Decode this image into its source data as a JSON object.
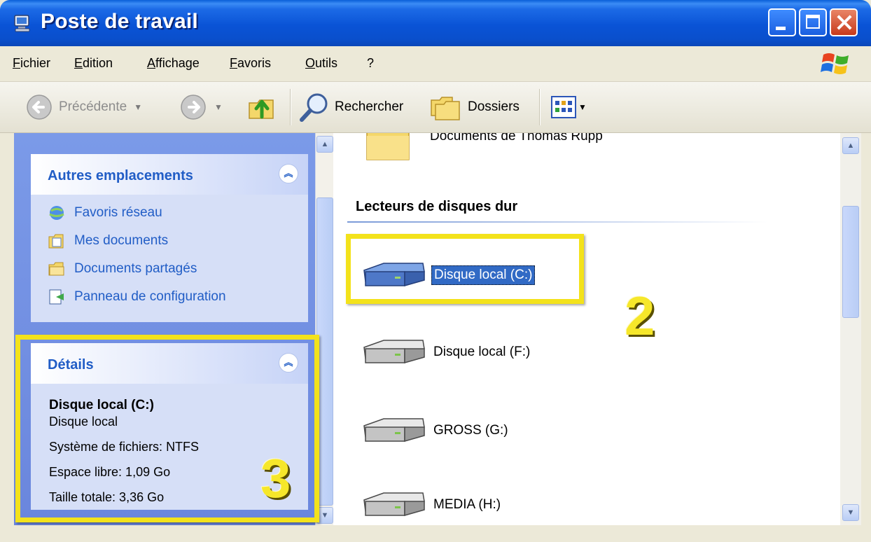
{
  "window": {
    "title": "Poste de travail"
  },
  "menu": [
    "Fichier",
    "Edition",
    "Affichage",
    "Favoris",
    "Outils",
    "?"
  ],
  "toolbar": {
    "back_label": "Précédente",
    "search_label": "Rechercher",
    "folders_label": "Dossiers"
  },
  "left_pane": {
    "other_places": {
      "title": "Autres emplacements",
      "links": [
        "Favoris réseau",
        "Mes documents",
        "Documents partagés",
        "Panneau de configuration"
      ]
    },
    "details": {
      "title": "Détails",
      "name": "Disque local (C:)",
      "type": "Disque local",
      "filesystem": "Système de fichiers: NTFS",
      "free_space": "Espace libre: 1,09 Go",
      "total_size": "Taille totale: 3,36 Go"
    }
  },
  "main_pane": {
    "partial_folder": "Documents de Thomas Rupp",
    "group_title": "Lecteurs de disques dur",
    "drives": [
      "Disque local (C:)",
      "Disque local (F:)",
      "GROSS (G:)",
      "MEDIA (H:)"
    ],
    "selected_drive": "Disque local (C:)"
  },
  "annotations": {
    "label_2": "2",
    "label_3": "3"
  },
  "colors": {
    "title_bar": "#0a53d6",
    "selection": "#316ac5",
    "annotation": "#f3e21b",
    "link": "#215dc6",
    "task_pane": "#6a86dd"
  }
}
